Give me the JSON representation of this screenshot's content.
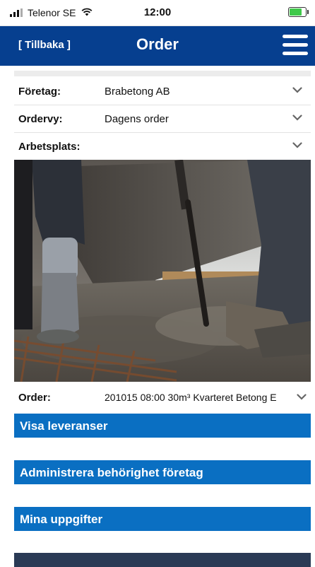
{
  "status_bar": {
    "carrier": "Telenor SE",
    "time": "12:00",
    "battery_level": 0.85,
    "battery_color": "#3fc94a"
  },
  "header": {
    "back_label": "[ Tillbaka ]",
    "title": "Order",
    "bg_color": "#063f8f"
  },
  "form": {
    "company": {
      "label": "Företag:",
      "value": "Brabetong AB"
    },
    "order_view": {
      "label": "Ordervy:",
      "value": "Dagens order"
    },
    "workplace": {
      "label": "Arbetsplats:",
      "value": ""
    },
    "order": {
      "label": "Order:",
      "value": "201015 08:00 30m³ Kvarteret Betong E"
    }
  },
  "buttons": {
    "show_deliveries": "Visa leveranser",
    "manage_permissions": "Administrera behörighet företag",
    "my_details": "Mina uppgifter"
  },
  "accent_color": "#0a6fc2"
}
